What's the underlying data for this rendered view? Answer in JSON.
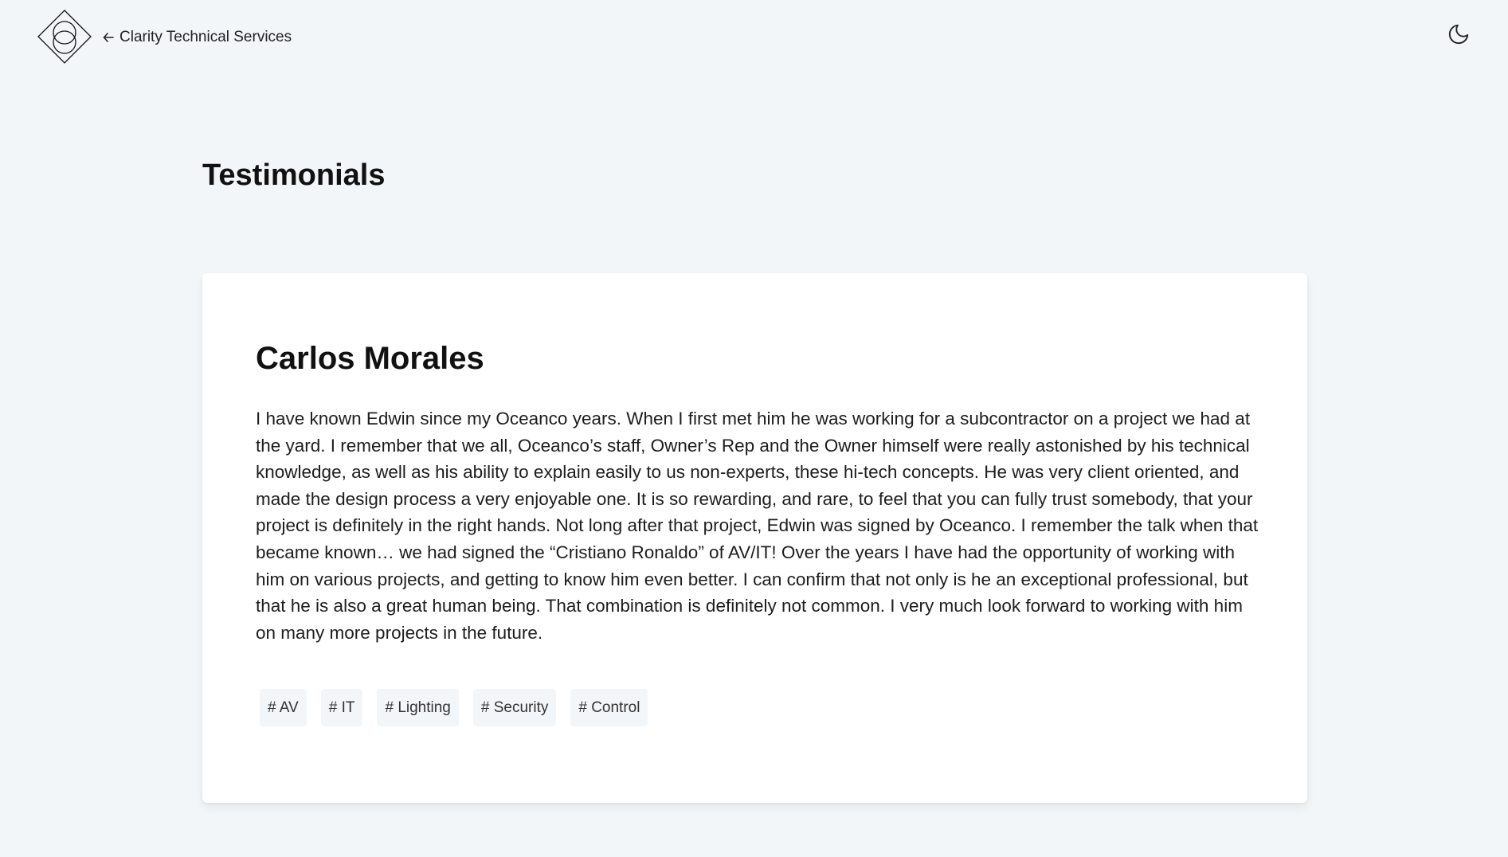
{
  "header": {
    "logo_icon": "diamond-circles-logo-icon",
    "back_label": "Clarity Technical Services",
    "back_icon": "arrow-left-icon",
    "theme_icon": "moon-icon"
  },
  "page": {
    "title": "Testimonials"
  },
  "testimonial": {
    "name": "Carlos Morales",
    "text": "I have known Edwin since my Oceanco years. When I first met him he was working for a subcontractor on a project we had at the yard. I remember that we all, Oceanco’s staff, Owner’s Rep and the Owner himself were really astonished by his technical knowledge, as well as his ability to explain easily to us non-experts, these hi-tech concepts. He was very client oriented, and made the design process a very enjoyable one. It is so rewarding, and rare, to feel that you can fully trust somebody, that your project is definitely in the right hands. Not long after that project, Edwin was signed by Oceanco. I remember the talk when that became known… we had signed the “Cristiano Ronaldo” of AV/IT! Over the years I have had the opportunity of working with him on various projects, and getting to know him even better. I can confirm that not only is he an exceptional professional, but that he is also a great human being. That combination is definitely not common. I very much look forward to working with him on many more projects in the future.",
    "tags": [
      "# AV",
      "# IT",
      "# Lighting",
      "# Security",
      "# Control"
    ]
  },
  "colors": {
    "page_background": "#f3f6f9",
    "card_background": "#ffffff",
    "text": "#111111",
    "tag_background": "#f3f6f9"
  }
}
